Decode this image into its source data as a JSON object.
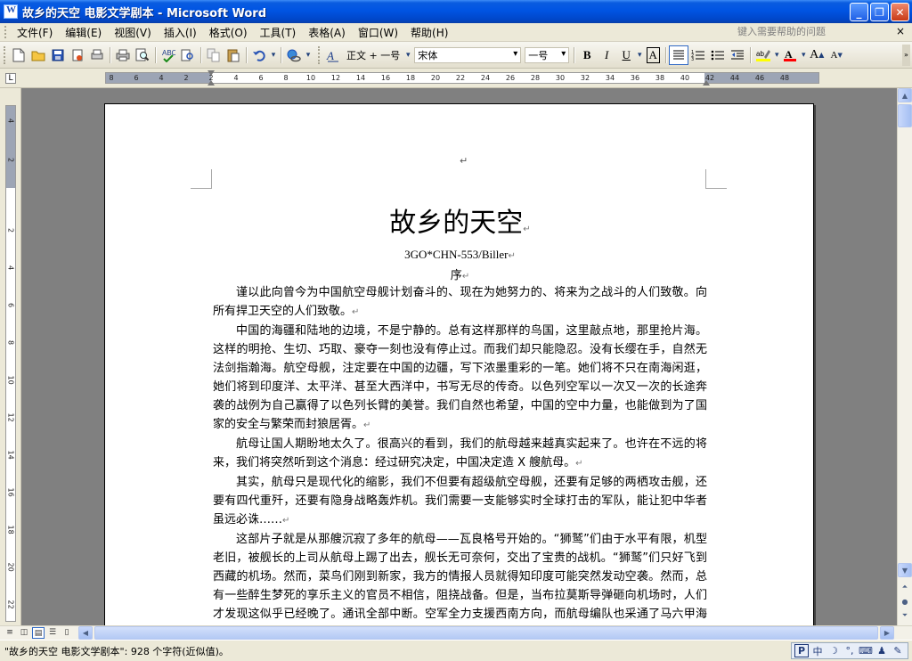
{
  "window": {
    "title": "故乡的天空 电影文学剧本 - Microsoft Word",
    "minimize_glyph": "_",
    "restore_glyph": "❐",
    "close_glyph": "✕"
  },
  "menu": {
    "items": [
      "文件(F)",
      "编辑(E)",
      "视图(V)",
      "插入(I)",
      "格式(O)",
      "工具(T)",
      "表格(A)",
      "窗口(W)",
      "帮助(H)"
    ],
    "help_placeholder": "键入需要帮助的问题",
    "close_glyph": "×"
  },
  "toolbar": {
    "style_label": "正文 + 一号",
    "font_label": "宋体",
    "size_label": "一号",
    "bold": "B",
    "italic": "I",
    "underline": "U",
    "char_border": "A",
    "font_grow": "A",
    "font_shrink": "A"
  },
  "ruler": {
    "ticks": [
      "8",
      "6",
      "4",
      "2",
      "2",
      "4",
      "6",
      "8",
      "10",
      "12",
      "14",
      "16",
      "18",
      "20",
      "22",
      "24",
      "26",
      "28",
      "30",
      "32",
      "34",
      "36",
      "38",
      "40",
      "42",
      "44",
      "46",
      "48"
    ],
    "corner_glyph": "L"
  },
  "vruler": {
    "ticks": [
      "4",
      "2",
      "2",
      "4",
      "6",
      "8",
      "10",
      "12",
      "14",
      "16",
      "18",
      "20",
      "22"
    ]
  },
  "document": {
    "top_para_mark": "↵",
    "title": "故乡的天空",
    "subtitle": "3GO*CHN-553/Biller",
    "section": "序",
    "para_mark": "↵",
    "paragraphs": [
      "谨以此向曾今为中国航空母舰计划奋斗的、现在为她努力的、将来为之战斗的人们致敬。向所有捍卫天空的人们致敬。",
      "中国的海疆和陆地的边境，不是宁静的。总有这样那样的鸟国，这里敲点地，那里抢片海。这样的明抢、生切、巧取、豪夺一刻也没有停止过。而我们却只能隐忍。没有长缨在手，自然无法剑指瀚海。航空母舰，注定要在中国的边疆，写下浓墨重彩的一笔。她们将不只在南海闲逛，她们将到印度洋、太平洋、甚至大西洋中，书写无尽的传奇。以色列空军以一次又一次的长途奔袭的战例为自己赢得了以色列长臂的美誉。我们自然也希望，中国的空中力量，也能做到为了国家的安全与繁荣而封狼居胥。",
      "航母让国人期盼地太久了。很高兴的看到，我们的航母越来越真实起来了。也许在不远的将来，我们将突然听到这个消息：经过研究决定，中国决定造 X 艘航母。",
      "其实，航母只是现代化的缩影，我们不但要有超级航空母舰，还要有足够的两栖攻击舰，还要有四代重歼，还要有隐身战略轰炸机。我们需要一支能够实时全球打击的军队，能让犯中华者虽远必诛……",
      "这部片子就是从那艘沉寂了多年的航母——瓦良格号开始的。“狮鹫”们由于水平有限，机型老旧，被舰长的上司从航母上踢了出去，舰长无可奈何，交出了宝贵的战机。“狮鹫”们只好飞到西藏的机场。然而，菜鸟们刚到新家，我方的情报人员就得知印度可能突然发动空袭。然而，总有一些醉生梦死的享乐主义的官员不相信，阻挠战备。但是，当布拉莫斯导弹砸向机场时，人们才发现这似乎已经晚了。通讯全部中断。空军全力支援西南方向，而航母编队也采通了马六甲海峡的国家，顺利开进印度洋。"
    ]
  },
  "statusbar": {
    "text": "\"故乡的天空 电影文学剧本\": 928 个字符(近似值)。",
    "ime": [
      "P",
      "中",
      "☽",
      "°,",
      "⌨",
      "♟",
      "✎"
    ]
  }
}
